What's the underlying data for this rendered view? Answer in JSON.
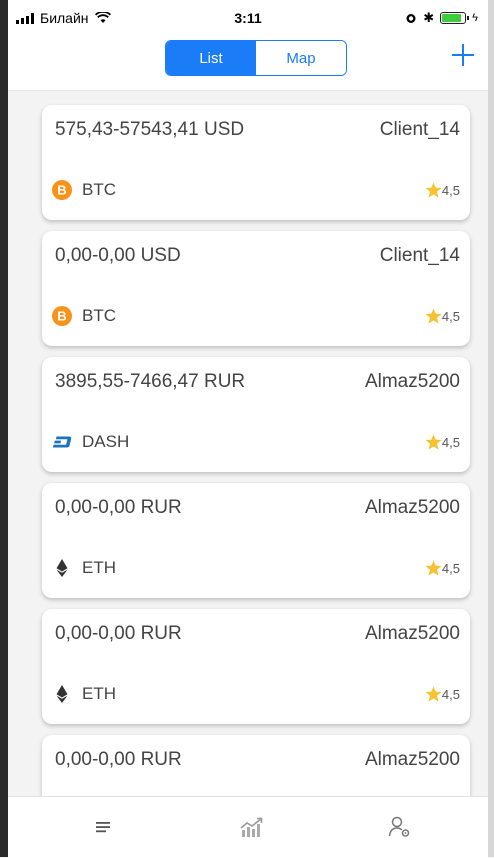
{
  "status_bar": {
    "carrier": "Билайн",
    "time": "3:11",
    "battery_level": 0.9
  },
  "nav": {
    "segments": [
      "List",
      "Map"
    ],
    "selected_segment": "List",
    "accent_color": "#1a7cf7"
  },
  "offers": [
    {
      "range": "575,43-57543,41 USD",
      "client": "Client_14",
      "currency": "BTC",
      "icon": "bitcoin-icon",
      "rating": "4,5"
    },
    {
      "range": "0,00-0,00 USD",
      "client": "Client_14",
      "currency": "BTC",
      "icon": "bitcoin-icon",
      "rating": "4,5"
    },
    {
      "range": "3895,55-7466,47 RUR",
      "client": "Almaz5200",
      "currency": "DASH",
      "icon": "dash-icon",
      "rating": "4,5"
    },
    {
      "range": "0,00-0,00 RUR",
      "client": "Almaz5200",
      "currency": "ETH",
      "icon": "ethereum-icon",
      "rating": "4,5"
    },
    {
      "range": "0,00-0,00 RUR",
      "client": "Almaz5200",
      "currency": "ETH",
      "icon": "ethereum-icon",
      "rating": "4,5"
    },
    {
      "range": "0,00-0,00 RUR",
      "client": "Almaz5200",
      "currency": "",
      "icon": "",
      "rating": ""
    }
  ],
  "tab_bar": {
    "tabs": [
      "list-tab",
      "stats-tab",
      "profile-tab"
    ],
    "selected": "list-tab"
  }
}
